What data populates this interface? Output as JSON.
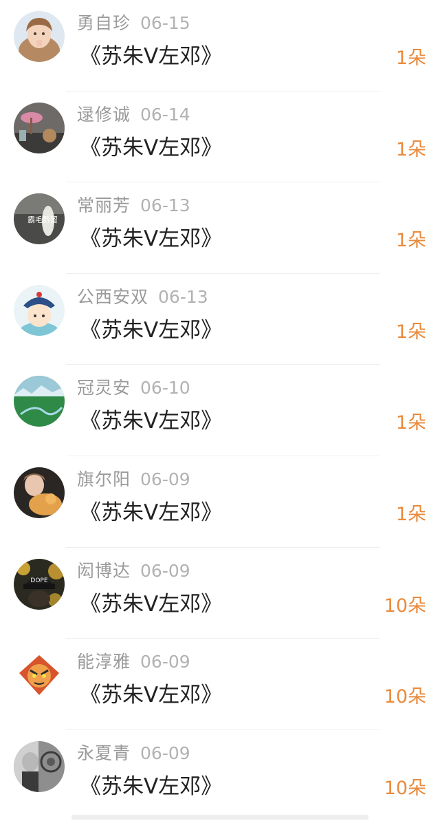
{
  "rows": [
    {
      "name": "勇自珍",
      "date": "06-15",
      "gift": "《苏朱V左邓》",
      "count": "1朵"
    },
    {
      "name": "逯修诚",
      "date": "06-14",
      "gift": "《苏朱V左邓》",
      "count": "1朵"
    },
    {
      "name": "常丽芳",
      "date": "06-13",
      "gift": "《苏朱V左邓》",
      "count": "1朵"
    },
    {
      "name": "公西安双",
      "date": "06-13",
      "gift": "《苏朱V左邓》",
      "count": "1朵"
    },
    {
      "name": "冠灵安",
      "date": "06-10",
      "gift": "《苏朱V左邓》",
      "count": "1朵"
    },
    {
      "name": "旗尔阳",
      "date": "06-09",
      "gift": "《苏朱V左邓》",
      "count": "1朵"
    },
    {
      "name": "闳博达",
      "date": "06-09",
      "gift": "《苏朱V左邓》",
      "count": "10朵"
    },
    {
      "name": "能淳雅",
      "date": "06-09",
      "gift": "《苏朱V左邓》",
      "count": "10朵"
    },
    {
      "name": "永夏青",
      "date": "06-09",
      "gift": "《苏朱V左邓》",
      "count": "10朵"
    }
  ],
  "avatar_texts": {
    "row2": "霸毛黔留",
    "row6": "DOPE"
  },
  "colors": {
    "count": "#e98a3c",
    "name": "#9a9a9a",
    "gift": "#222222"
  }
}
